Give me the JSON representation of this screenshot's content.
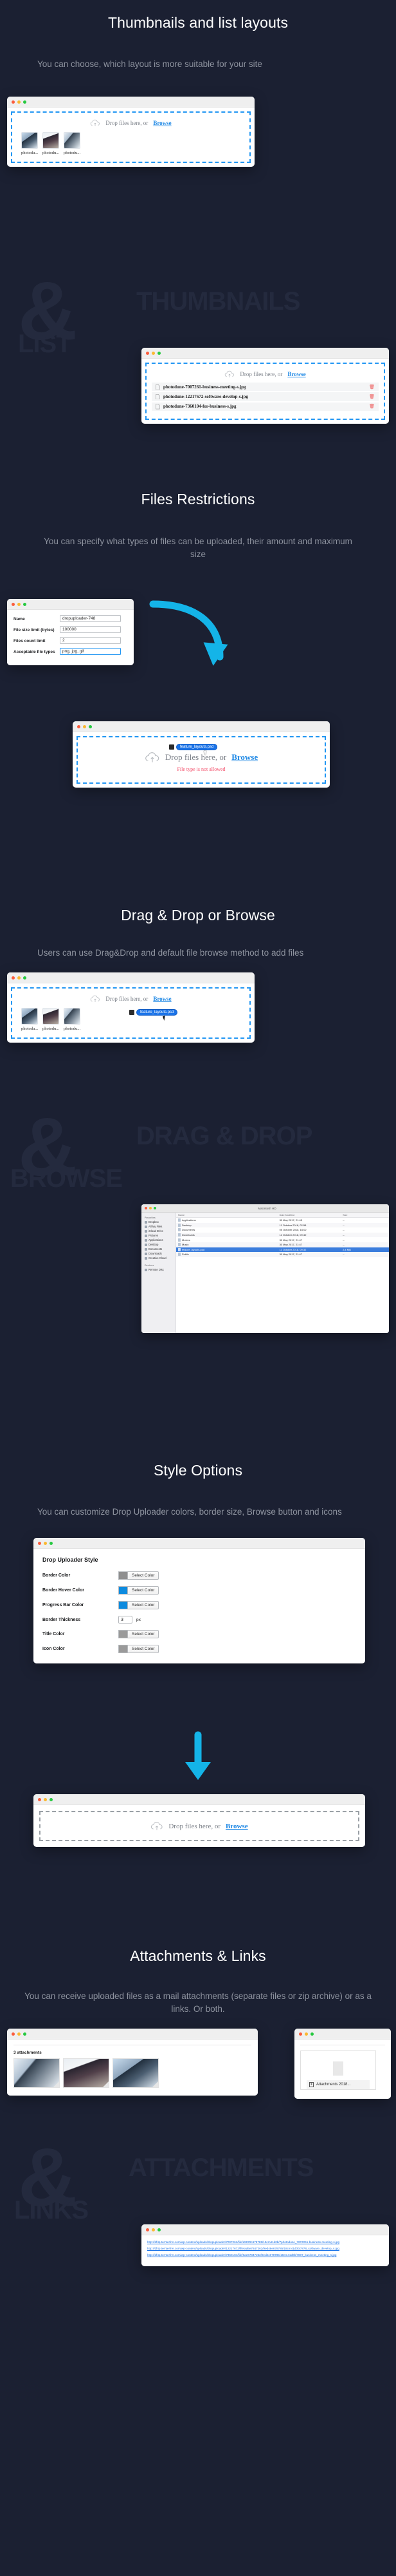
{
  "theme": {
    "bg": "#1b2032",
    "watermark": "#242a3e",
    "accent": "#2196f3",
    "link": "#1e88e5",
    "error": "#f4516c",
    "cyan_arrow": "#14b4e8"
  },
  "sections": [
    {
      "id": "thumbnails-list",
      "title": "Thumbnails and list layouts",
      "subtitle": "You can choose, which layout is more suitable for your site",
      "watermark": {
        "amp": "&",
        "word_top": "THUMBNAILS",
        "word_bottom": "LIST"
      }
    },
    {
      "id": "files-restrictions",
      "title": "Files Restrictions",
      "subtitle": "You can specify what types of files can be uploaded, their amount and maximum size"
    },
    {
      "id": "drag-drop-browse",
      "title": "Drag & Drop or Browse",
      "subtitle": "Users can use Drag&Drop and default file browse method to add files",
      "watermark": {
        "amp": "&",
        "word_top": "DRAG & DROP",
        "word_bottom": "BROWSE"
      }
    },
    {
      "id": "style-options",
      "title": "Style Options",
      "subtitle": "You can customize Drop Uploader colors, border size, Browse button and icons"
    },
    {
      "id": "attachments-links",
      "title": "Attachments & Links",
      "subtitle": "You can receive uploaded files as a mail attachments (separate files or zip archive) or as a links. Or both.",
      "watermark": {
        "amp": "&",
        "word_top": "ATTACHMENTS",
        "word_bottom": "LINKS"
      }
    }
  ],
  "dropzone": {
    "label": "Drop files here, or",
    "browse": "Browse",
    "icon": "cloud-upload-icon"
  },
  "thumbnails_window": {
    "files": [
      {
        "caption": "photodu..."
      },
      {
        "caption": "photodu..."
      },
      {
        "caption": "photodu..."
      }
    ]
  },
  "list_window": {
    "files": [
      {
        "name": "photodune-7007261-business-meeting-s.jpg",
        "delete": "delete-icon"
      },
      {
        "name": "photodune-12217672-software-develop-s.jpg",
        "delete": "delete-icon"
      },
      {
        "name": "photodune-7360104-for-business-s.jpg",
        "delete": "delete-icon"
      }
    ]
  },
  "restrictions_form": {
    "fields": [
      {
        "label": "Name",
        "value": "dropuploader-748",
        "focused": false
      },
      {
        "label": "File size limit (bytes)",
        "value": "100000",
        "focused": false
      },
      {
        "label": "Files count limit",
        "value": "2",
        "focused": false
      },
      {
        "label": "Acceptable file types",
        "value": "png, jpg, gif",
        "focused": true
      }
    ]
  },
  "error_window": {
    "drag_chip": "feature_layouts.psd",
    "error_text": "File type is not allowed"
  },
  "drag_browse_window": {
    "files": [
      {
        "caption": "photodu..."
      },
      {
        "caption": "photodu..."
      },
      {
        "caption": "photodu..."
      }
    ],
    "drag_chip": "feature_layouts.psd"
  },
  "finder": {
    "sidebar_groups": [
      {
        "title": "Favorites",
        "items": [
          "Dropbox",
          "All My Files",
          "iCloud Drive",
          "Pictures",
          "Applications",
          "Desktop",
          "Documents",
          "Downloads",
          "Creative Cloud"
        ]
      },
      {
        "title": "Devices",
        "items": [
          "Remote Disc"
        ]
      }
    ],
    "columns": [
      "Name",
      "Date Modified",
      "Size"
    ],
    "rows": [
      {
        "name": "Applications",
        "date": "30 May 2017, 21:45",
        "size": "--"
      },
      {
        "name": "Desktop",
        "date": "11 October 2018, 02:58",
        "size": "--"
      },
      {
        "name": "Documents",
        "date": "05 October 2018, 16:02",
        "size": "--"
      },
      {
        "name": "Downloads",
        "date": "11 October 2018, 09:40",
        "size": "--"
      },
      {
        "name": "Movies",
        "date": "30 May 2017, 21:47",
        "size": "--"
      },
      {
        "name": "Music",
        "date": "30 May 2017, 21:47",
        "size": "--"
      },
      {
        "name": "feature_layouts.psd",
        "date": "11 October 2018, 09:32",
        "size": "2,4 MB"
      },
      {
        "name": "Public",
        "date": "30 May 2017, 21:47",
        "size": "--"
      }
    ],
    "title": "Macintosh HD"
  },
  "style_panel": {
    "title": "Drop Uploader Style",
    "select_color_label": "Select Color",
    "rows": [
      {
        "label": "Border Color",
        "type": "color",
        "swatch": "#8f8f8f"
      },
      {
        "label": "Border Hover Color",
        "type": "color",
        "swatch": "#0d8bdf"
      },
      {
        "label": "Progress Bar Color",
        "type": "color",
        "swatch": "#0d8bdf"
      },
      {
        "label": "Border Thickness",
        "type": "number",
        "value": "3",
        "unit": "px"
      },
      {
        "label": "Title Color",
        "type": "color",
        "swatch": "#9a9a9a"
      },
      {
        "label": "Icon Color",
        "type": "color",
        "swatch": "#9a9a9a"
      }
    ]
  },
  "mail_window": {
    "attachments_count": "3 attachments"
  },
  "zip_window": {
    "file_label": "Attachments 2018..."
  },
  "links_window": {
    "links": [
      "http://df4p.ternterfrer.com/wp-content/uploads/dropuploader/7007261/file/d9878c678785/18cm41d0b/7photodune_7007261-business-meeting-s.jpg",
      "http://df4p.ternterfrer.com/wp-content/uploads/dropuploader/12217672/file/ad6e7847262/9ed48e678785/18cm41d0b/7878_software_develop_s.jpg",
      "http://df4p.ternterfrer.com/wp-content/uploads/dropuploader/7360104/file/0ae67847262/9ed4c678785/18cm41d0b/7807_business_meeting_s.jpg"
    ]
  }
}
